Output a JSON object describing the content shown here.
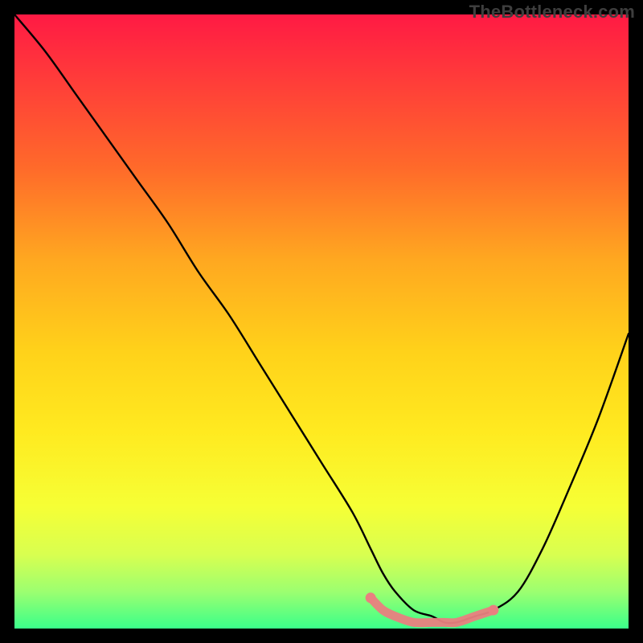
{
  "watermark": "TheBottleneck.com",
  "colors": {
    "frame": "#000000",
    "curve": "#000000",
    "highlight": "#e98080",
    "gradient_top": "#ff1a44",
    "gradient_bottom": "#3aff8a"
  },
  "chart_data": {
    "type": "line",
    "title": "",
    "xlabel": "",
    "ylabel": "",
    "xlim": [
      0,
      100
    ],
    "ylim": [
      0,
      100
    ],
    "grid": false,
    "legend": false,
    "annotations": [
      "TheBottleneck.com"
    ],
    "series": [
      {
        "name": "bottleneck-curve",
        "x": [
          0,
          5,
          10,
          15,
          20,
          25,
          30,
          35,
          40,
          45,
          50,
          55,
          58,
          60,
          62,
          65,
          68,
          70,
          72,
          75,
          78,
          82,
          86,
          90,
          95,
          100
        ],
        "values": [
          100,
          94,
          87,
          80,
          73,
          66,
          58,
          51,
          43,
          35,
          27,
          19,
          13,
          9,
          6,
          3,
          2,
          1,
          1,
          2,
          3,
          6,
          13,
          22,
          34,
          48
        ]
      },
      {
        "name": "optimal-flat-region",
        "x": [
          58,
          60,
          62,
          65,
          68,
          70,
          72,
          75,
          78
        ],
        "values": [
          5,
          3,
          2,
          1,
          1,
          1,
          1,
          2,
          3
        ]
      }
    ]
  }
}
